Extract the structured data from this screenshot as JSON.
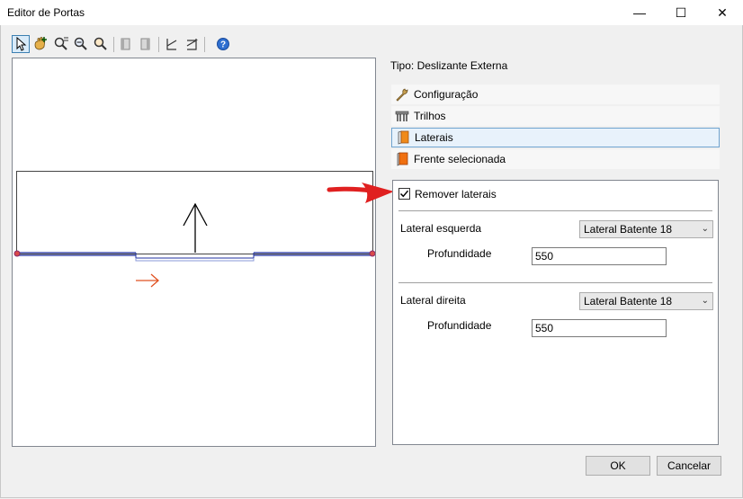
{
  "window": {
    "title": "Editor de Portas",
    "minimize_glyph": "—",
    "maximize_glyph": "☐",
    "close_glyph": "✕"
  },
  "toolbar": {
    "items": [
      "select-pointer-icon",
      "hand-add-icon",
      "zoom-window-icon",
      "zoom-out-icon",
      "zoom-extents-icon",
      "panel-left-icon",
      "panel-right-icon",
      "front-left-icon",
      "front-right-icon",
      "help-icon"
    ]
  },
  "tipo": "Tipo: Deslizante Externa",
  "sections": [
    {
      "label": "Configuração",
      "icon": "wrench-icon"
    },
    {
      "label": "Trilhos",
      "icon": "rails-icon"
    },
    {
      "label": "Laterais",
      "icon": "side-panel-icon"
    },
    {
      "label": "Frente selecionada",
      "icon": "front-panel-icon"
    }
  ],
  "laterais": {
    "remove_label": "Remover laterais",
    "remove_checked": true,
    "left": {
      "label": "Lateral esquerda",
      "select": "Lateral Batente 18",
      "depth_label": "Profundidade",
      "depth": "550"
    },
    "right": {
      "label": "Lateral direita",
      "select": "Lateral Batente 18",
      "depth_label": "Profundidade",
      "depth": "550"
    }
  },
  "buttons": {
    "ok": "OK",
    "cancel": "Cancelar"
  },
  "colors": {
    "accent": "#3c7fb1",
    "annotation_arrow": "#e02020",
    "drawing_blue": "#1f2fa0",
    "drawing_orange": "#e05020"
  }
}
